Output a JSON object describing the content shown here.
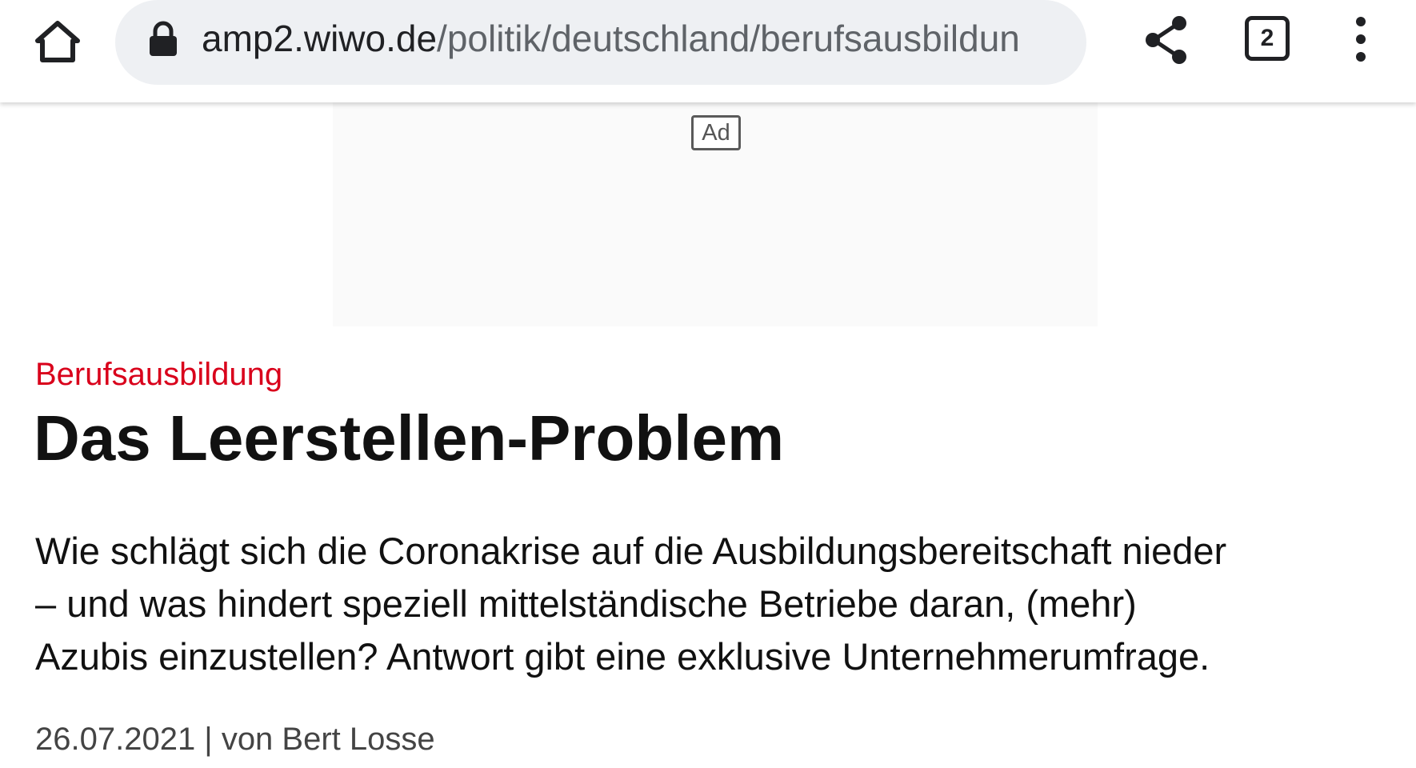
{
  "browser": {
    "url_host": "amp2.wiwo.de",
    "url_path": "/politik/deutschland/berufsausbildun",
    "tab_count": "2",
    "icons": {
      "home": "home-icon",
      "lock": "lock-icon",
      "share": "share-icon",
      "tabs": "tab-switcher-icon",
      "menu": "more-vert-icon"
    }
  },
  "ad": {
    "label": "Ad"
  },
  "article": {
    "kicker": "Berufsausbildung",
    "headline": "Das Leerstellen-Problem",
    "teaser_lines": [
      "Wie schlägt sich die Coronakrise auf die Ausbildungsbereitschaft nieder",
      "– und was hindert speziell mittelständische Betriebe daran, (mehr)",
      "Azubis einzustellen? Antwort gibt eine exklusive Unternehmerumfrage."
    ],
    "byline": "26.07.2021 | von Bert Losse"
  },
  "colors": {
    "kicker": "#d9001b",
    "url_bar_bg": "#eef0f3",
    "text": "#111111"
  }
}
